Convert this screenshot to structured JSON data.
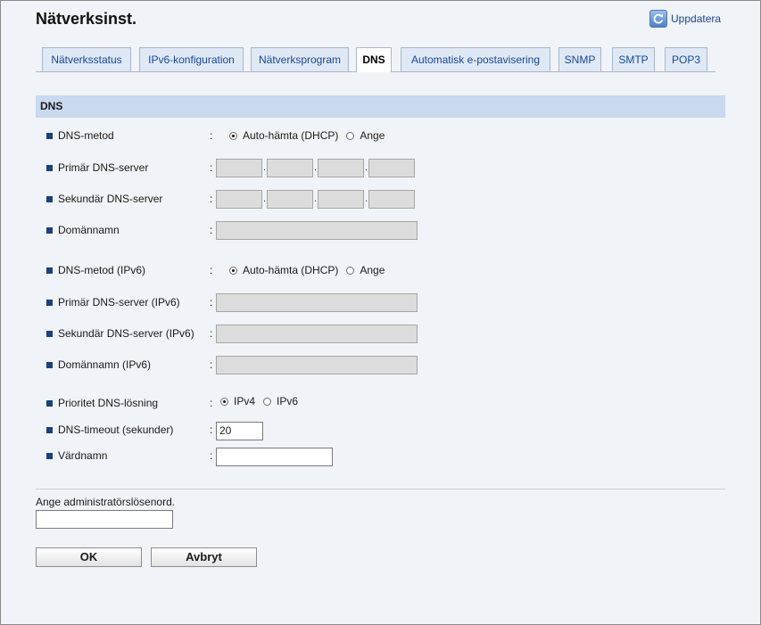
{
  "page": {
    "title": "Nätverksinst."
  },
  "header": {
    "refresh_label": "Uppdatera"
  },
  "tabs": [
    "Nätverksstatus",
    "IPv6-konfiguration",
    "Nätverksprogram",
    "DNS",
    "Automatisk e-postavisering",
    "SNMP",
    "SMTP",
    "POP3"
  ],
  "active_tab": "DNS",
  "section": {
    "title": "DNS"
  },
  "rows": {
    "dns_method": {
      "label": "DNS-metod",
      "opt1": "Auto-hämta (DHCP)",
      "opt2": "Ange",
      "selected": "Auto-hämta (DHCP)"
    },
    "primary_dns": {
      "label": "Primär DNS-server"
    },
    "secondary_dns": {
      "label": "Sekundär DNS-server"
    },
    "domain": {
      "label": "Domännamn"
    },
    "dns_method_v6": {
      "label": "DNS-metod (IPv6)",
      "opt1": "Auto-hämta (DHCP)",
      "opt2": "Ange",
      "selected": "Auto-hämta (DHCP)"
    },
    "primary_dns_v6": {
      "label": "Primär DNS-server (IPv6)"
    },
    "secondary_dns_v6": {
      "label": "Sekundär DNS-server (IPv6)"
    },
    "domain_v6": {
      "label": "Domännamn (IPv6)"
    },
    "priority": {
      "label": "Prioritet DNS-lösning",
      "opt1": "IPv4",
      "opt2": "IPv6",
      "selected": "IPv4"
    },
    "timeout": {
      "label": "DNS-timeout (sekunder)",
      "value": "20"
    },
    "hostname": {
      "label": "Värdnamn",
      "value": ""
    }
  },
  "colon": ":",
  "ip_dot": ".",
  "admin": {
    "label": "Ange administratörslösenord.",
    "value": ""
  },
  "buttons": {
    "ok": "OK",
    "cancel": "Avbryt"
  },
  "colors": {
    "tab_bg": "#dfe9f5",
    "section_bg": "#c8d9f0",
    "link": "#16469c",
    "bullet": "#1c3f86"
  },
  "icons": {
    "refresh": "refresh-icon",
    "bullet": "square-bullet-icon"
  }
}
